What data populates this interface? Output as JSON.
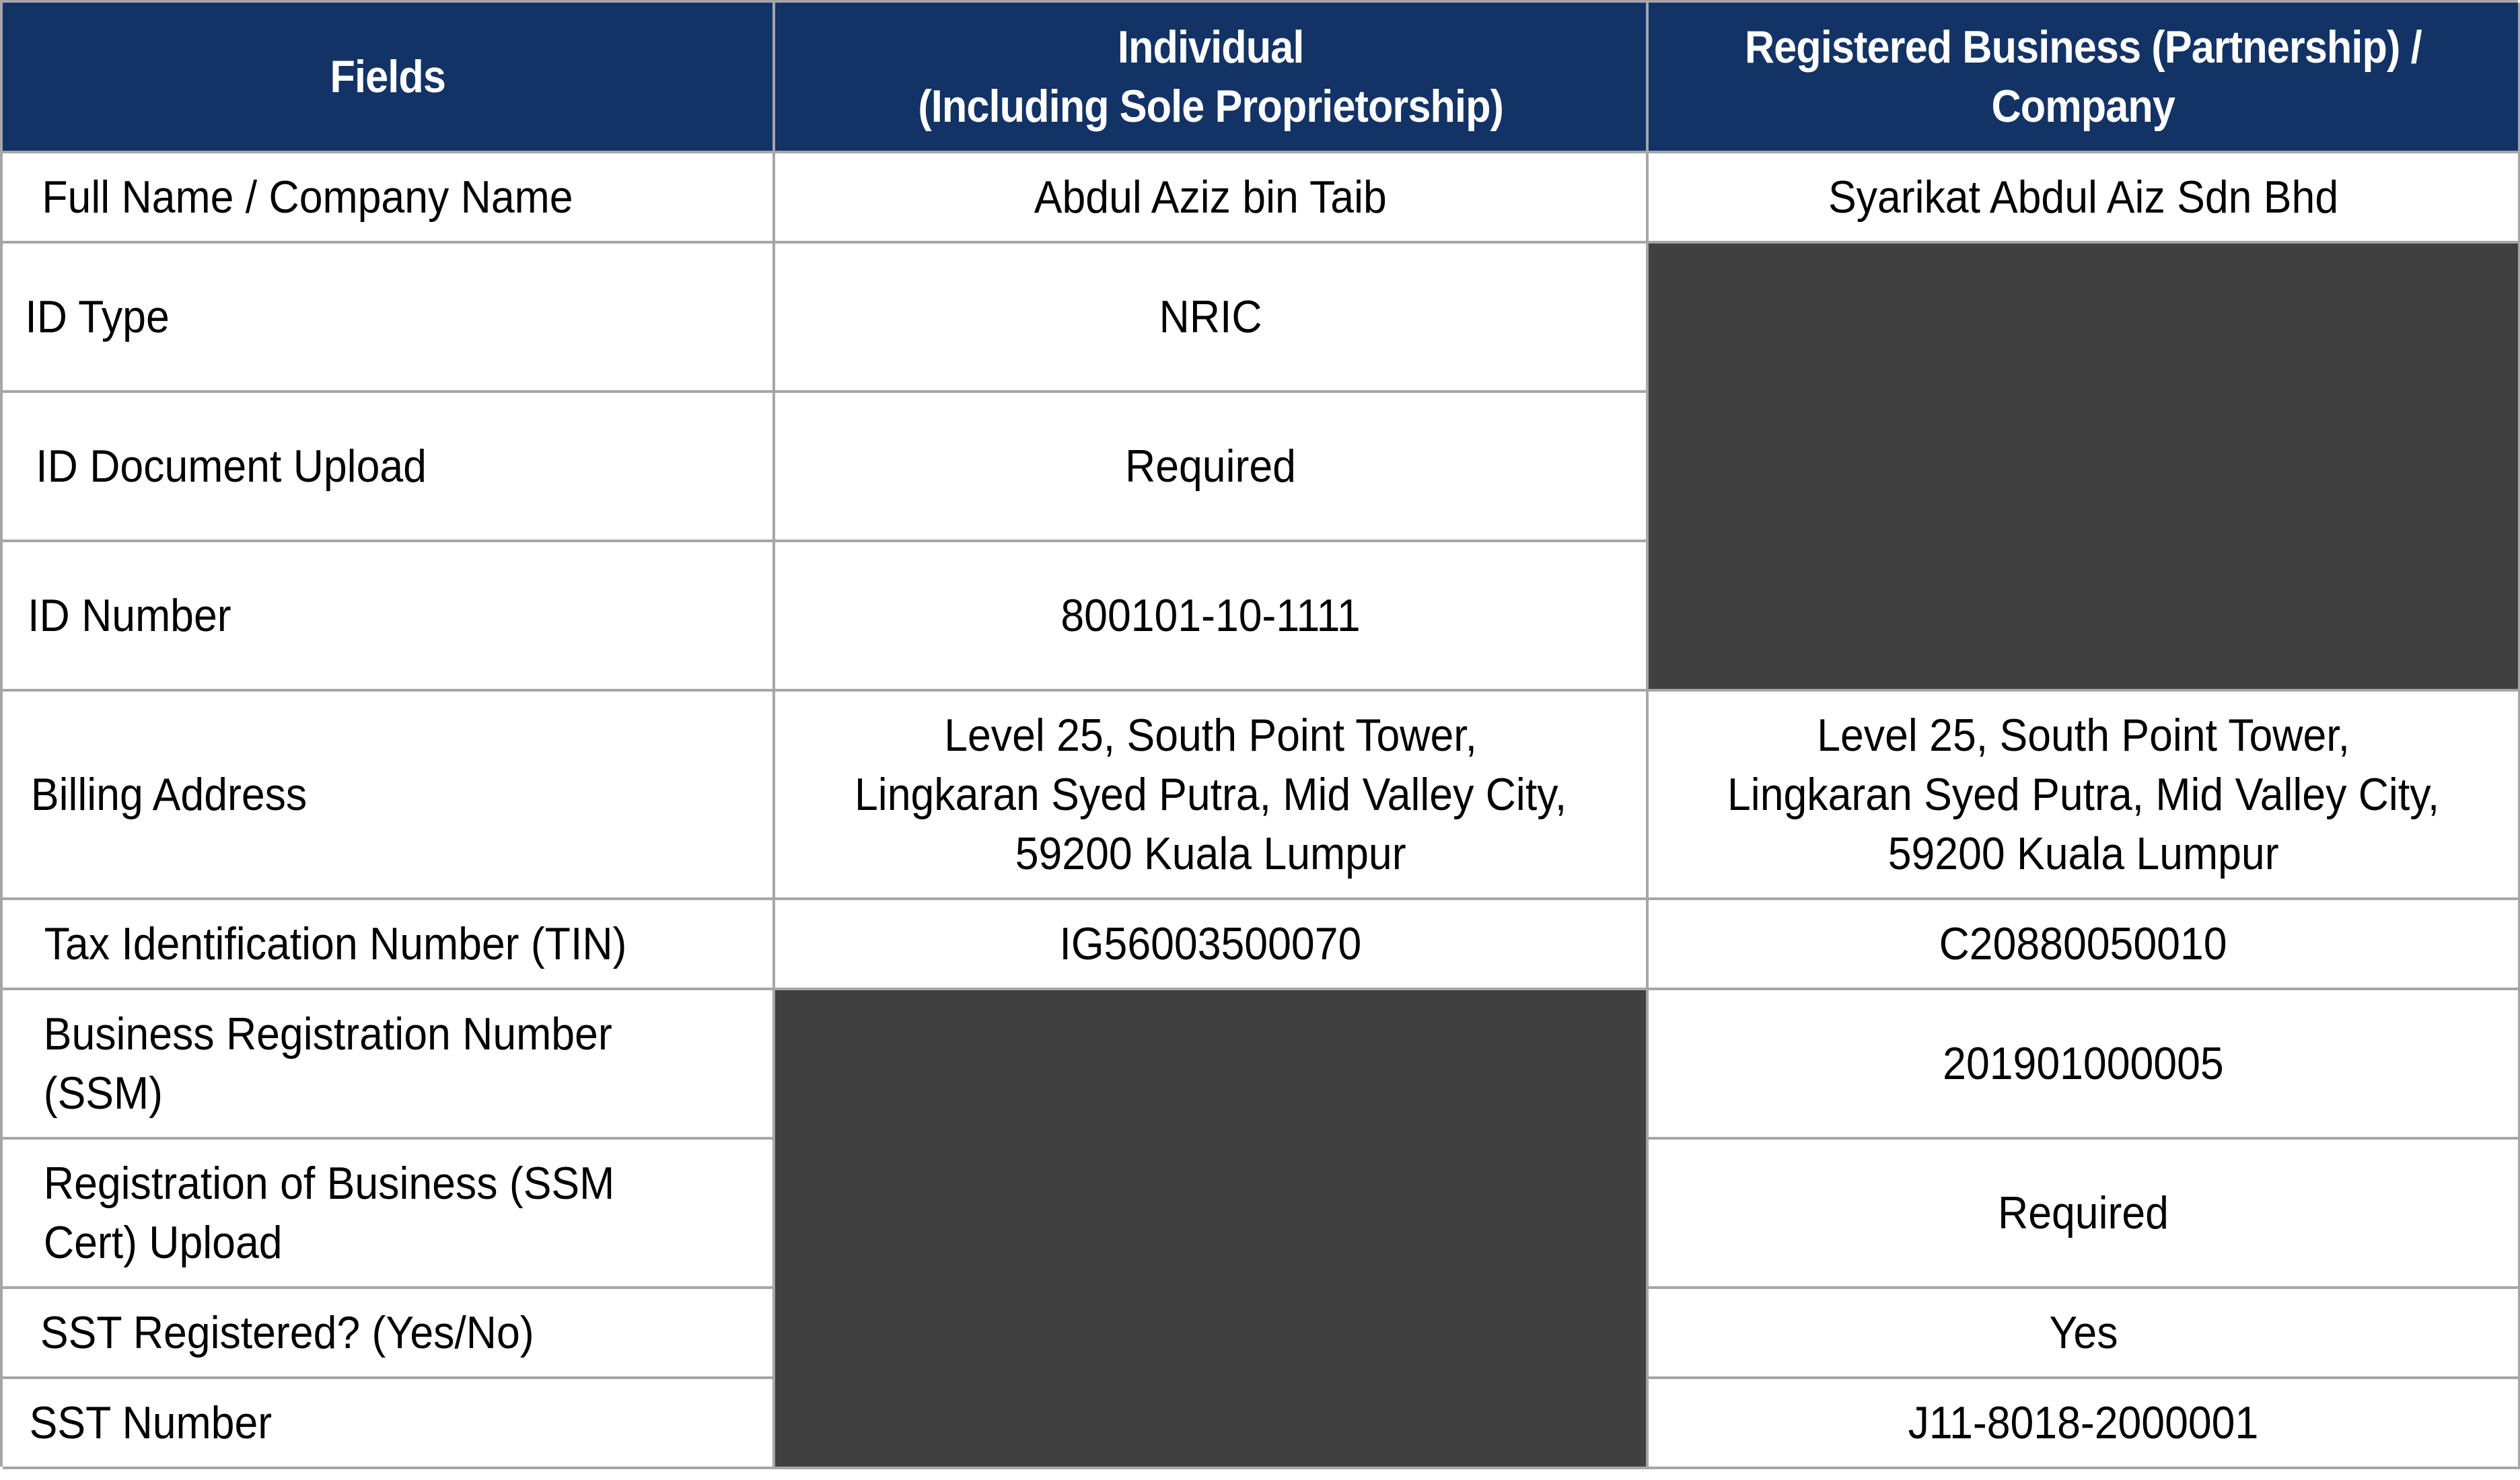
{
  "colors": {
    "header_bg": "#133366",
    "header_text": "#ffffff",
    "border": "#a6a6a6",
    "not_applicable_fill": "#404040"
  },
  "table": {
    "headers": [
      "Fields",
      "Individual\n(Including Sole Proprietorship)",
      "Registered Business (Partnership) /\nCompany"
    ],
    "rows": [
      {
        "field": "Full Name / Company Name",
        "individual": "Abdul Aziz bin Taib",
        "business": "Syarikat Abdul Aiz Sdn Bhd"
      },
      {
        "field": "ID Type",
        "individual": "NRIC",
        "business": null
      },
      {
        "field": "ID Document Upload",
        "individual": "Required",
        "business": null
      },
      {
        "field": "ID Number",
        "individual": "800101-10-1111",
        "business": null
      },
      {
        "field": "Billing Address",
        "individual": "Level 25, South Point Tower,\nLingkaran Syed Putra, Mid Valley City,\n59200 Kuala Lumpur",
        "business": "Level 25, South Point Tower,\nLingkaran Syed Putra, Mid Valley City,\n59200 Kuala Lumpur"
      },
      {
        "field": "Tax Identification Number (TIN)",
        "individual": "IG56003500070",
        "business": "C20880050010"
      },
      {
        "field": "Business Registration Number\n(SSM)",
        "individual": null,
        "business": "201901000005"
      },
      {
        "field": "Registration of Business (SSM\nCert) Upload",
        "individual": null,
        "business": "Required"
      },
      {
        "field": "SST Registered? (Yes/No)",
        "individual": null,
        "business": "Yes"
      },
      {
        "field": "SST Number",
        "individual": null,
        "business": "J11-8018-2000001"
      }
    ]
  }
}
